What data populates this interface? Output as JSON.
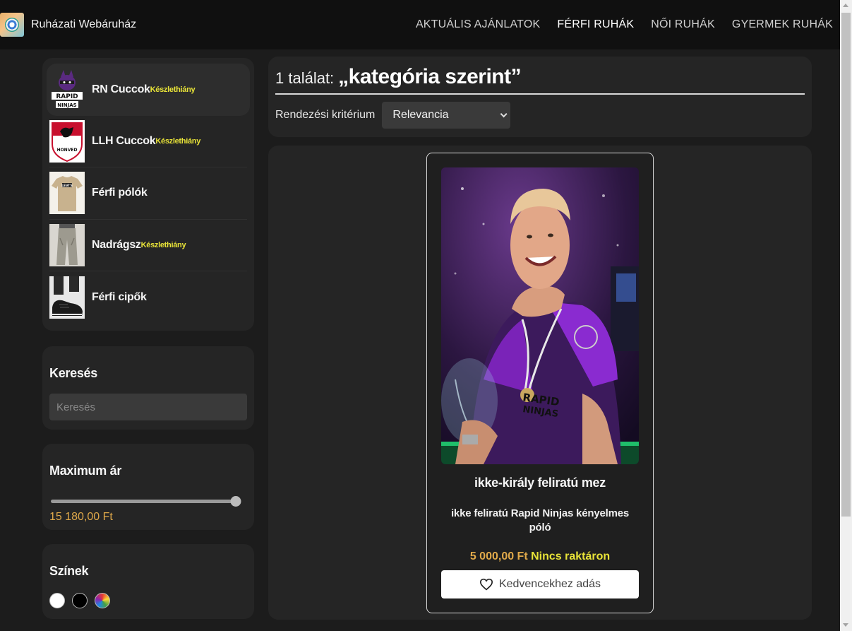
{
  "navbar": {
    "brand": "Ruházati Webáruház",
    "links": [
      {
        "label": "AKTUÁLIS AJÁNLATOK"
      },
      {
        "label": "FÉRFI RUHÁK"
      },
      {
        "label": "NŐI RUHÁK"
      },
      {
        "label": "GYERMEK RUHÁK"
      }
    ],
    "active_link": "FÉRFI RUHÁK"
  },
  "sidebar": {
    "categories": [
      {
        "label": "RN Cuccok",
        "badge": "Készlethiány",
        "icon": "rapid-ninjas-logo"
      },
      {
        "label": "LLH Cuccok",
        "badge": "Készlethiány",
        "icon": "llh-logo"
      },
      {
        "label": "Férfi pólók",
        "badge": "",
        "icon": "tshirt-photo"
      },
      {
        "label": "Nadrágsz",
        "badge": "Készlethiány",
        "icon": "pants-photo"
      },
      {
        "label": "Férfi cipők",
        "badge": "",
        "icon": "shoes-photo"
      }
    ],
    "search": {
      "title": "Keresés",
      "placeholder": "Keresés"
    },
    "price": {
      "title": "Maximum ár",
      "value": "15 180,00 Ft",
      "slider_fraction": 1.0
    },
    "colors": {
      "title": "Színek",
      "swatches": [
        "#ffffff",
        "#000000",
        "rainbow"
      ]
    }
  },
  "results": {
    "count_text": "1 találat:",
    "query_text": "„kategória szerint”",
    "sort_label": "Rendezési kritérium",
    "sort_value": "Relevancia"
  },
  "product": {
    "title": "ikke-király feliratú mez",
    "description": "ikke feliratú Rapid Ninjas kényelmes póló",
    "price": "5 000,00 Ft",
    "stock": "Nincs raktáron",
    "favorite_label": "Kedvencekhez adás"
  },
  "colors": {
    "accent_price": "#e0a94a",
    "badge_yellow": "#e8e338",
    "background": "#1c1c1c",
    "panel": "#252525"
  }
}
